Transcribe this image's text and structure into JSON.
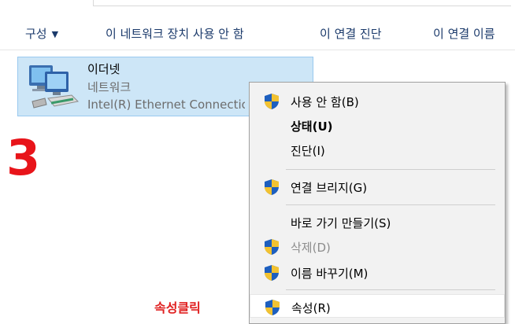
{
  "toolbar": {
    "organize": "구성",
    "disable": "이 네트워크 장치 사용 안 함",
    "diagnose": "이 연결 진단",
    "rename": "이 연결 이름"
  },
  "adapter": {
    "name": "이더넷",
    "network": "네트워크",
    "hardware": "Intel(R) Ethernet Connection"
  },
  "annotation": {
    "step": "3",
    "hint": "속성클릭",
    "hint_color": "#e02020",
    "step_color": "#e8141a"
  },
  "context_menu": {
    "items": [
      {
        "label": "사용 안 함(B)",
        "icon": "uac-shield-icon"
      },
      {
        "label": "상태(U)",
        "bold": true
      },
      {
        "label": "진단(I)"
      },
      {
        "label": "연결 브리지(G)",
        "icon": "uac-shield-icon"
      },
      {
        "label": "바로 가기 만들기(S)"
      },
      {
        "label": "삭제(D)",
        "icon": "uac-shield-icon",
        "disabled": true
      },
      {
        "label": "이름 바꾸기(M)",
        "icon": "uac-shield-icon"
      },
      {
        "label": "속성(R)",
        "icon": "uac-shield-icon",
        "highlighted": true
      }
    ]
  }
}
